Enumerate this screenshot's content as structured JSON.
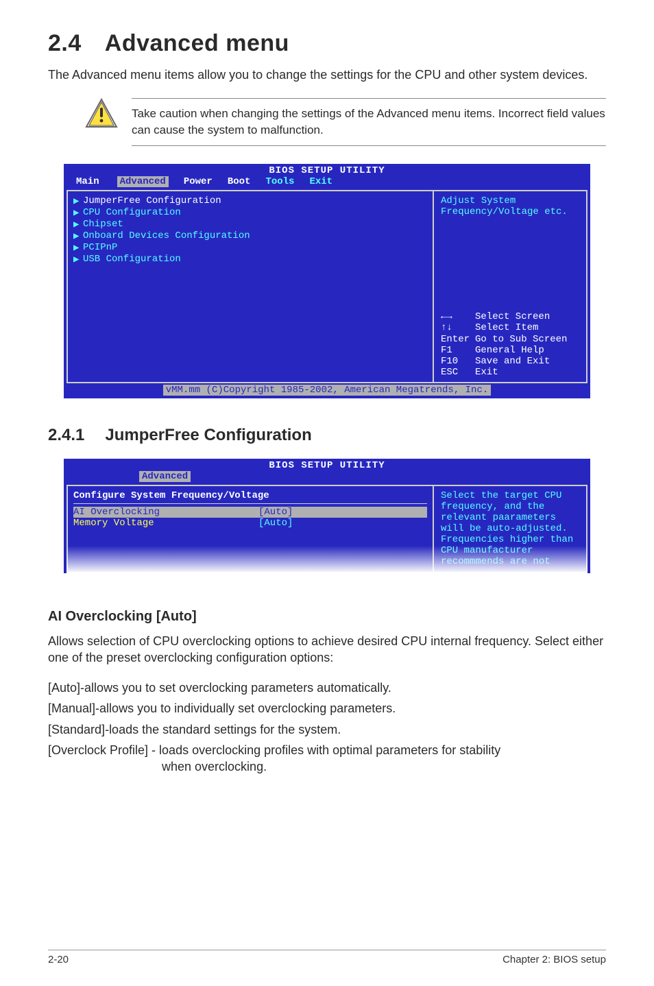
{
  "title": {
    "number": "2.4",
    "text": "Advanced menu"
  },
  "lead": "The Advanced menu items allow you to change the settings for the CPU and other system devices.",
  "caution": "Take caution when changing the settings of the Advanced menu items. Incorrect field values can cause the system to malfunction.",
  "bios1": {
    "title": "BIOS SETUP UTILITY",
    "tabs": [
      "Main",
      "Advanced",
      "Power",
      "Boot",
      "Tools",
      "Exit"
    ],
    "active_tab": "Advanced",
    "items": [
      "JumperFree Configuration",
      "CPU Configuration",
      "Chipset",
      "Onboard Devices Configuration",
      "PCIPnP",
      "USB Configuration"
    ],
    "help": "Adjust System Frequency/Voltage etc.",
    "keys": [
      {
        "k": "←→",
        "d": "Select Screen"
      },
      {
        "k": "↑↓",
        "d": "Select Item"
      },
      {
        "k": "Enter",
        "d": "Go to Sub Screen"
      },
      {
        "k": "F1",
        "d": "General Help"
      },
      {
        "k": "F10",
        "d": "Save and Exit"
      },
      {
        "k": "ESC",
        "d": "Exit"
      }
    ],
    "footer": "vMM.mm (C)Copyright 1985-2002, American Megatrends, Inc."
  },
  "subsection": {
    "number": "2.4.1",
    "text": "JumperFree Configuration"
  },
  "bios2": {
    "title": "BIOS SETUP UTILITY",
    "active_tab": "Advanced",
    "section_head": "Configure System Frequency/Voltage",
    "fields": [
      {
        "label": "AI Overclocking",
        "value": "[Auto]",
        "selected": true
      },
      {
        "label": "Memory Voltage",
        "value": "[Auto]",
        "selected": false
      }
    ],
    "help": "Select the target CPU frequency, and the relevant paarameters will be auto-adjusted. Frequencies higher than CPU manufacturer recommmends are not"
  },
  "option": {
    "heading": "AI Overclocking [Auto]",
    "lead": "Allows selection of CPU overclocking options to achieve desired CPU internal frequency. Select either one of the preset overclocking configuration options:",
    "items": [
      {
        "key": "[Auto]",
        "sep": " - ",
        "desc": "allows you to set overclocking parameters automatically."
      },
      {
        "key": "[Manual]",
        "sep": " - ",
        "desc": "allows you to individually set overclocking parameters."
      },
      {
        "key": "[Standard]",
        "sep": " - ",
        "desc": "loads the standard settings for the system."
      },
      {
        "key": "[Overclock Profile]",
        "sep": " - ",
        "desc": "loads overclocking profiles with optimal parameters for stability",
        "desc2": "when overclocking."
      }
    ]
  },
  "footer": {
    "left": "2-20",
    "right": "Chapter 2: BIOS setup"
  }
}
